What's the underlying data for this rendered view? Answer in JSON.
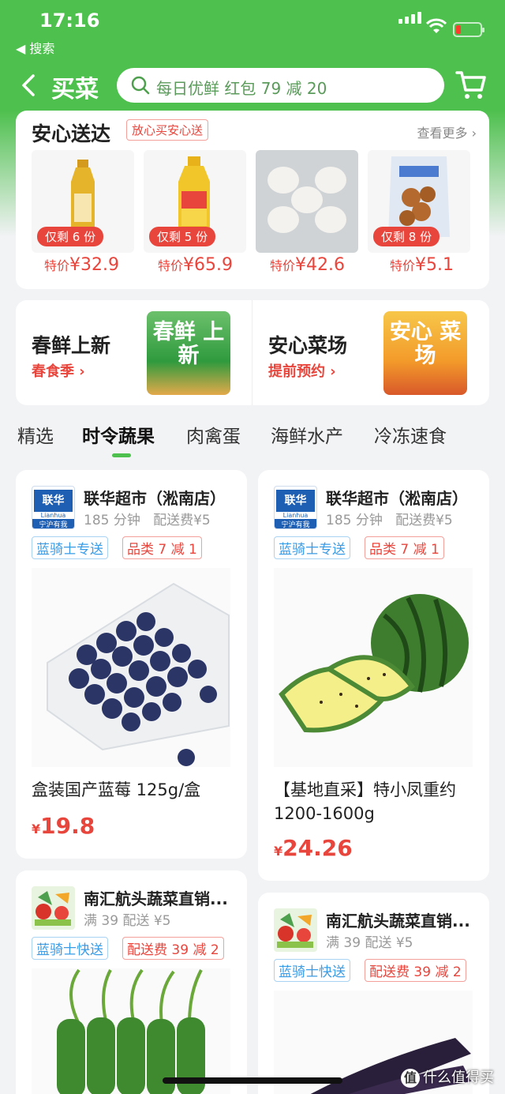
{
  "status": {
    "time": "17:16",
    "back_app": "◀ 搜索"
  },
  "nav": {
    "title": "买菜",
    "search_placeholder": "每日优鲜 红包 79 减 20"
  },
  "anxin": {
    "title": "安心送达",
    "tag": "放心买安心送",
    "more": "查看更多",
    "products": [
      {
        "badge": "仅剩 6 份",
        "label": "特价",
        "price": "¥32.9",
        "icon": "oil-bottle-small-icon"
      },
      {
        "badge": "仅剩 5 份",
        "label": "特价",
        "price": "¥65.9",
        "icon": "oil-bottle-large-icon"
      },
      {
        "badge": "",
        "label": "特价",
        "price": "¥42.6",
        "icon": "eggs-icon"
      },
      {
        "badge": "仅剩 8 份",
        "label": "特价",
        "price": "¥5.1",
        "icon": "dried-mushroom-bag-icon"
      }
    ]
  },
  "promos": [
    {
      "title": "春鲜上新",
      "sub": "春食季",
      "img_text": "春鲜 上新",
      "color": "#3aa84a"
    },
    {
      "title": "安心菜场",
      "sub": "提前预约",
      "img_text": "安心 菜场",
      "color": "#f39a2a"
    }
  ],
  "tabs": [
    "精选",
    "时令蔬果",
    "肉禽蛋",
    "海鲜水产",
    "冷冻速食"
  ],
  "active_tab": "时令蔬果",
  "feed": [
    {
      "store": "联华超市（淞南店）",
      "sub1": "185 分钟",
      "sub2": "配送费¥5",
      "tag_blue": "蓝骑士专送",
      "tag_red": "品类 7 减 1",
      "name": "盒装国产蓝莓 125g/盒",
      "currency": "¥",
      "price": "19.8",
      "logo_text": "联华",
      "logo_sub": "Lianhua",
      "logo_slogan": "宁沪有我"
    },
    {
      "store": "联华超市（淞南店）",
      "sub1": "185 分钟",
      "sub2": "配送费¥5",
      "tag_blue": "蓝骑士专送",
      "tag_red": "品类 7 减 1",
      "name": "【基地直采】特小凤重约1200-1600g",
      "currency": "¥",
      "price": "24.26",
      "logo_text": "联华",
      "logo_sub": "Lianhua",
      "logo_slogan": "宁沪有我"
    },
    {
      "store": "南汇航头蔬菜直销...",
      "sub1": "满 39 配送",
      "sub2": "¥5",
      "tag_blue": "蓝骑士快送",
      "tag_red": "配送费 39 减 2"
    },
    {
      "store": "南汇航头蔬菜直销...",
      "sub1": "满 39 配送",
      "sub2": "¥5",
      "tag_blue": "蓝骑士快送",
      "tag_red": "配送费 39 减 2"
    }
  ],
  "watermark": "什么值得买",
  "watermark_icon": "值"
}
